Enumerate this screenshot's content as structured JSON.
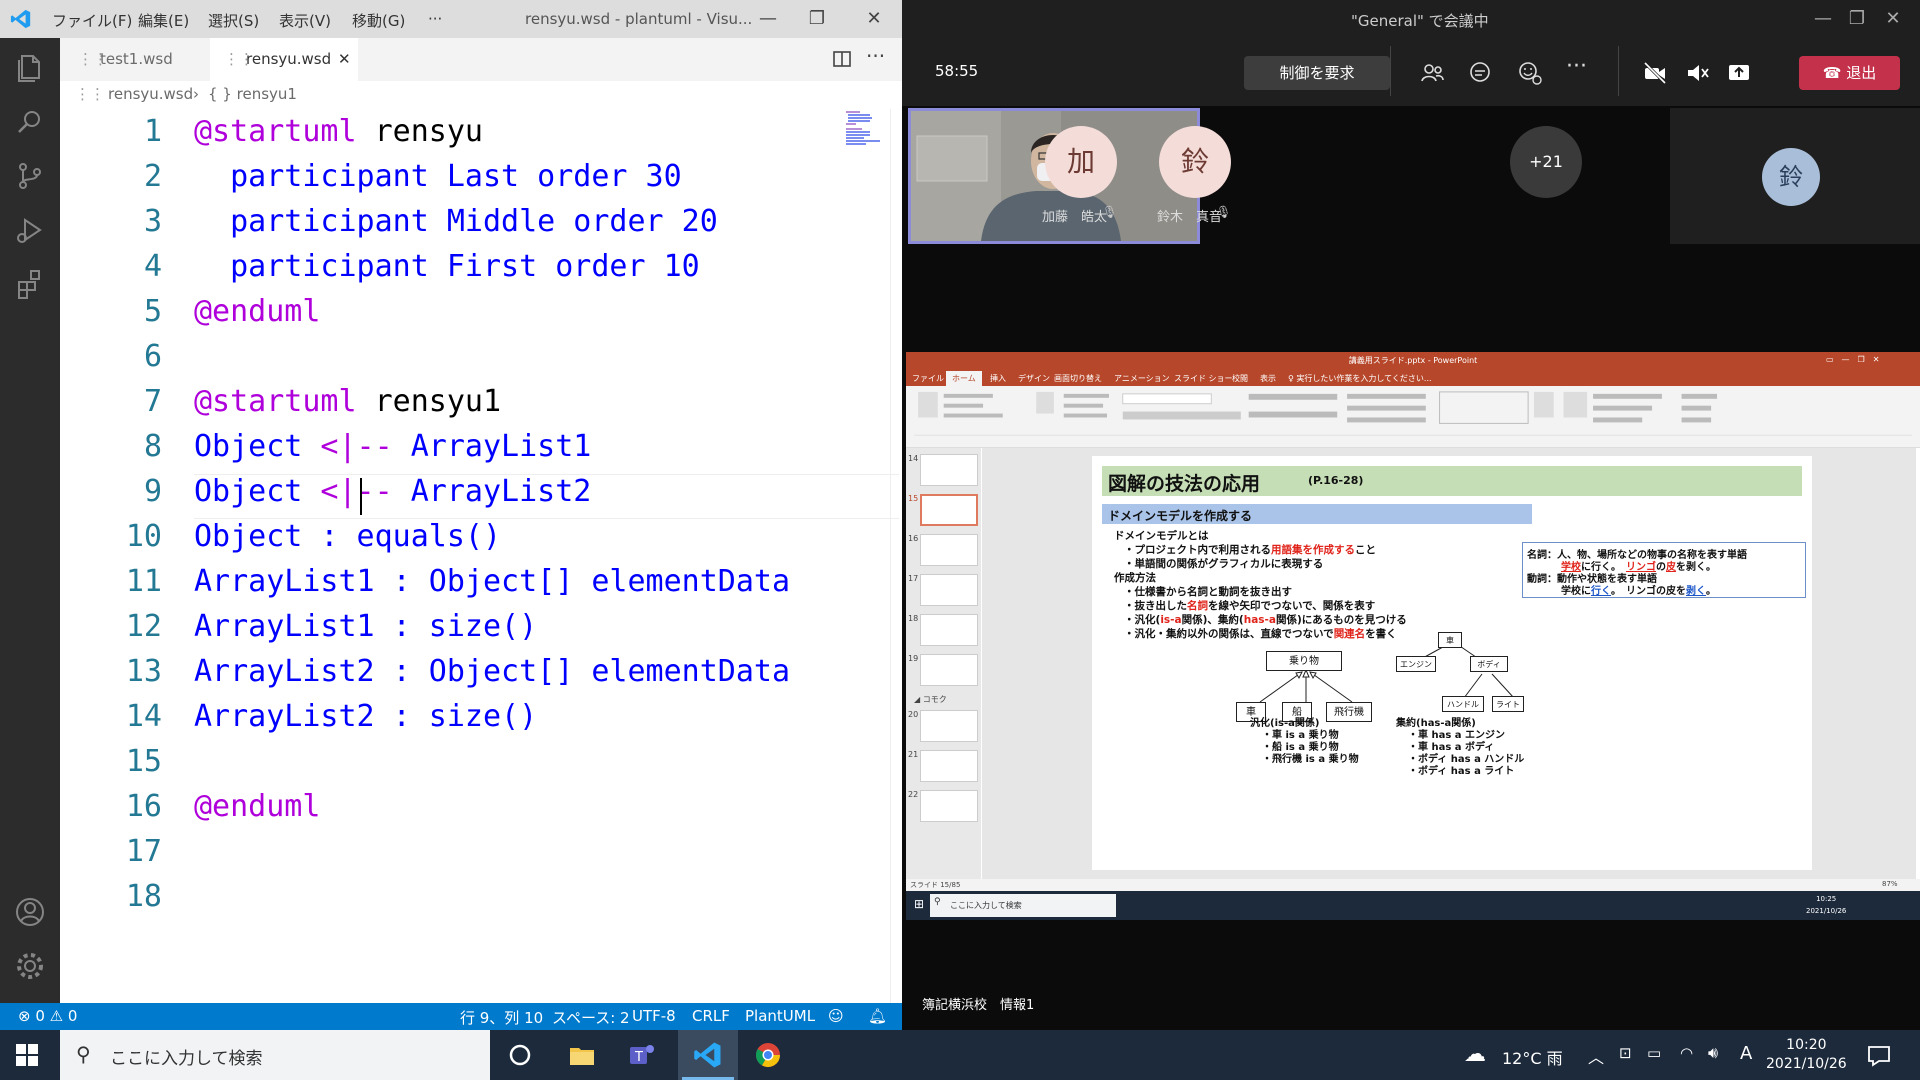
{
  "vscode": {
    "menu": [
      "ファイル(F)",
      "編集(E)",
      "選択(S)",
      "表示(V)",
      "移動(G)",
      "···"
    ],
    "window_title": "rensyu.wsd - plantuml - Visu...",
    "tabs": [
      {
        "label": "test1.wsd",
        "active": false
      },
      {
        "label": "rensyu.wsd",
        "active": true
      }
    ],
    "breadcrumb": {
      "file": "rensyu.wsd",
      "symbol": "{ } rensyu1"
    },
    "line_numbers": [
      "1",
      "2",
      "3",
      "4",
      "5",
      "6",
      "7",
      "8",
      "9",
      "10",
      "11",
      "12",
      "13",
      "14",
      "15",
      "16",
      "17",
      "18"
    ],
    "code": {
      "l1a": "@startuml",
      "l1b": " rensyu",
      "l2": "  participant Last order 30",
      "l3": "  participant Middle order 20",
      "l4": "  participant First order 10",
      "l5": "@enduml",
      "l7a": "@startuml",
      "l7b": " rensyu1",
      "l8a": "Object",
      "l8b": " <|--",
      "l8c": " ArrayList1",
      "l9a": "Object",
      "l9b": " <|--",
      "l9c": " ArrayList2",
      "l10": "Object : equals()",
      "l11": "ArrayList1 : Object[] elementData",
      "l12": "ArrayList1 : size()",
      "l13": "ArrayList2 : Object[] elementData",
      "l14": "ArrayList2 : size()",
      "l16": "@enduml"
    },
    "status": {
      "errors": "⊗ 0 ⚠ 0",
      "position": "行 9、列 10",
      "spaces": "スペース: 2",
      "encoding": "UTF-8",
      "eol": "CRLF",
      "language": "PlantUML"
    }
  },
  "teams": {
    "title": "\"General\" で会議中",
    "timer": "58:55",
    "request_control": "制御を要求",
    "leave": "退出",
    "participants": [
      {
        "initial": "加",
        "name": "加藤　皓太"
      },
      {
        "initial": "鈴",
        "name": "鈴木　真音"
      }
    ],
    "more": "+21",
    "right_initial": "鈴",
    "share_caption": "簿記横浜校　情報1"
  },
  "ppt": {
    "title": "講義用スライド.pptx - PowerPoint",
    "tabs": [
      "ファイル",
      "ホーム",
      "挿入",
      "デザイン",
      "画面切り替え",
      "アニメーション",
      "スライド ショー",
      "校閲",
      "表示",
      "♀ 実行したい作業を入力してください..."
    ],
    "thumb_nums": [
      "14",
      "15",
      "16",
      "17",
      "18",
      "19",
      "20",
      "21",
      "22"
    ],
    "section": "◢ コモク",
    "status": "スライド 15/85",
    "zoom": "87%",
    "search": "ここに入力して検索",
    "clock": "10:25\n2021/10/26",
    "slide": {
      "title": "図解の技法の応用",
      "page_ref": "(P.16-28)",
      "subtitle": "ドメインモデルを作成する",
      "lines": [
        "ドメインモデルとは",
        "・プロジェクト内で利用される",
        "用語集を作成する",
        "こと",
        "・単語間の関係がグラフィカルに表現する",
        "作成方法",
        "・仕様書から名詞と動詞を抜き出す",
        "・抜き出した",
        "名詞",
        "を線や矢印でつないで、関係を表す",
        "・汎化(",
        "is-a",
        "関係)、集約(",
        "has-a",
        "関係)にあるものを見つける",
        "・汎化・集約以外の関係は、直線でつないで",
        "関連名",
        "を書く"
      ],
      "callout": {
        "noun_label": "名詞：人、物、場所などの物事の名称を表す単語",
        "noun_ex_a": "学校",
        "noun_ex_b": "に行く。　",
        "noun_ex_c": "リンゴ",
        "noun_ex_d": "の",
        "noun_ex_e": "皮",
        "noun_ex_f": "を剥く。",
        "verb_label": "動詞：動作や状態を表す単語",
        "verb_ex_a": "学校に",
        "verb_ex_b": "行く",
        "verb_ex_c": "。　リンゴの皮を",
        "verb_ex_d": "剥く",
        "verb_ex_e": "。"
      },
      "diagram1": {
        "parent": "乗り物",
        "children": [
          "車",
          "船",
          "飛行機"
        ]
      },
      "diagram2": {
        "root": "車",
        "children": [
          "エンジン",
          "ボディ"
        ],
        "grand": [
          "ハンドル",
          "ライト"
        ]
      },
      "gen_caption": [
        "汎化(is-a関係)",
        "・車 is a 乗り物",
        "・船 is a 乗り物",
        "・飛行機 is a 乗り物"
      ],
      "agg_caption": [
        "集約(has-a関係)",
        "・車 has a エンジン",
        "・車 has a ボディ",
        "・ボディ has a ハンドル",
        "・ボディ has a ライト"
      ]
    }
  },
  "taskbar": {
    "search": "ここに入力して検索",
    "weather": "12°C  雨",
    "ime": "A",
    "time": "10:20",
    "date": "2021/10/26"
  },
  "colors": {
    "vscode_blue": "#007acc",
    "teams_leave": "#c4314b",
    "ppt_orange": "#b7472a",
    "keyword_purple": "#af00db",
    "keyword_blue": "#0000ff"
  }
}
